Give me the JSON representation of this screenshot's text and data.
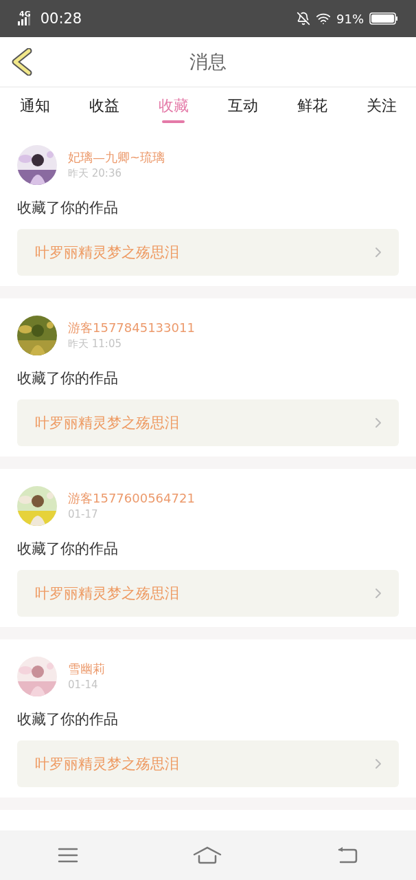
{
  "status_bar": {
    "network": "4G",
    "time": "00:28",
    "battery": "91%"
  },
  "header": {
    "title": "消息"
  },
  "tabs": [
    {
      "label": "通知",
      "selected": false
    },
    {
      "label": "收益",
      "selected": false
    },
    {
      "label": "收藏",
      "selected": true
    },
    {
      "label": "互动",
      "selected": false
    },
    {
      "label": "鲜花",
      "selected": false
    },
    {
      "label": "关注",
      "selected": false
    }
  ],
  "messages": [
    {
      "user": "妃璃—九卿~琉璃",
      "time": "昨天 20:36",
      "action": "收藏了你的作品",
      "work": "叶罗丽精灵梦之殇思泪"
    },
    {
      "user": "游客1577845133011",
      "time": "昨天 11:05",
      "action": "收藏了你的作品",
      "work": "叶罗丽精灵梦之殇思泪"
    },
    {
      "user": "游客1577600564721",
      "time": "01-17",
      "action": "收藏了你的作品",
      "work": "叶罗丽精灵梦之殇思泪"
    },
    {
      "user": "雪幽莉",
      "time": "01-14",
      "action": "收藏了你的作品",
      "work": "叶罗丽精灵梦之殇思泪"
    }
  ]
}
